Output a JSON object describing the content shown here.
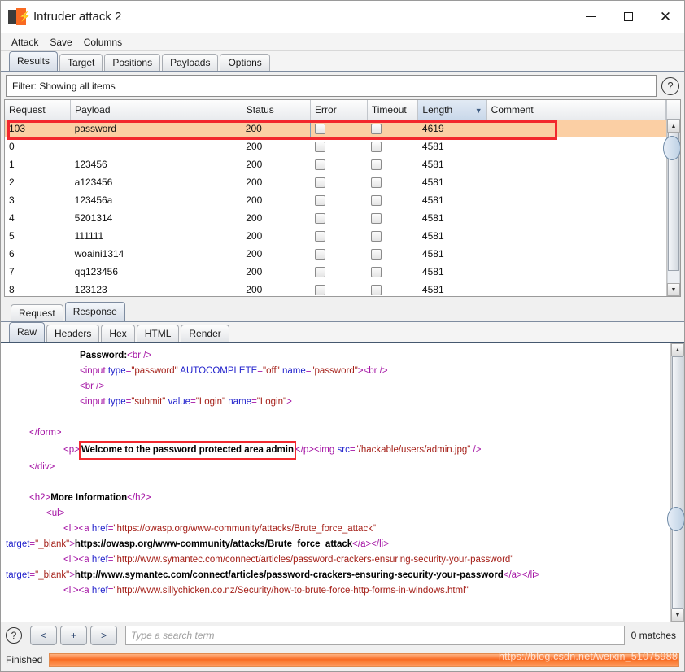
{
  "window": {
    "title": "Intruder attack 2",
    "icon": "burp-suite-logo",
    "minimize": "—",
    "maximize": "□",
    "close": "✕"
  },
  "menubar": {
    "items": [
      "Attack",
      "Save",
      "Columns"
    ]
  },
  "top_tabs": {
    "items": [
      "Results",
      "Target",
      "Positions",
      "Payloads",
      "Options"
    ],
    "active": "Results"
  },
  "filter": {
    "text": "Filter: Showing all items",
    "help_icon": "question-mark-icon",
    "help_glyph": "?"
  },
  "results_table": {
    "columns": [
      "Request",
      "Payload",
      "Status",
      "Error",
      "Timeout",
      "Length",
      "Comment"
    ],
    "sorted_column": "Length",
    "sort_arrow": "▼",
    "rows": [
      {
        "request": "103",
        "payload": "password",
        "status": "200",
        "error": "",
        "timeout": "",
        "length": "4619",
        "comment": "",
        "highlighted": true
      },
      {
        "request": "0",
        "payload": "",
        "status": "200",
        "error": "",
        "timeout": "",
        "length": "4581",
        "comment": "",
        "highlighted": false
      },
      {
        "request": "1",
        "payload": "123456",
        "status": "200",
        "error": "",
        "timeout": "",
        "length": "4581",
        "comment": "",
        "highlighted": false
      },
      {
        "request": "2",
        "payload": "a123456",
        "status": "200",
        "error": "",
        "timeout": "",
        "length": "4581",
        "comment": "",
        "highlighted": false
      },
      {
        "request": "3",
        "payload": "123456a",
        "status": "200",
        "error": "",
        "timeout": "",
        "length": "4581",
        "comment": "",
        "highlighted": false
      },
      {
        "request": "4",
        "payload": "5201314",
        "status": "200",
        "error": "",
        "timeout": "",
        "length": "4581",
        "comment": "",
        "highlighted": false
      },
      {
        "request": "5",
        "payload": "111111",
        "status": "200",
        "error": "",
        "timeout": "",
        "length": "4581",
        "comment": "",
        "highlighted": false
      },
      {
        "request": "6",
        "payload": "woaini1314",
        "status": "200",
        "error": "",
        "timeout": "",
        "length": "4581",
        "comment": "",
        "highlighted": false
      },
      {
        "request": "7",
        "payload": "qq123456",
        "status": "200",
        "error": "",
        "timeout": "",
        "length": "4581",
        "comment": "",
        "highlighted": false
      },
      {
        "request": "8",
        "payload": "123123",
        "status": "200",
        "error": "",
        "timeout": "",
        "length": "4581",
        "comment": "",
        "highlighted": false
      }
    ]
  },
  "rr_tabs": {
    "items": [
      "Request",
      "Response"
    ],
    "active": "Response"
  },
  "view_tabs": {
    "items": [
      "Raw",
      "Headers",
      "Hex",
      "HTML",
      "Render"
    ],
    "active": "Raw"
  },
  "response": {
    "lines": [
      [
        {
          "t": "Password:",
          "c": "tx"
        },
        {
          "t": "<br />",
          "c": "tg"
        }
      ],
      [
        {
          "t": "<input ",
          "c": "tg"
        },
        {
          "t": "type",
          "c": "at"
        },
        {
          "t": "=",
          "c": "tg"
        },
        {
          "t": "\"password\"",
          "c": "vl"
        },
        {
          "t": " AUTOCOMPLETE",
          "c": "at"
        },
        {
          "t": "=",
          "c": "tg"
        },
        {
          "t": "\"off\"",
          "c": "vl"
        },
        {
          "t": " name",
          "c": "at"
        },
        {
          "t": "=",
          "c": "tg"
        },
        {
          "t": "\"password\"",
          "c": "vl"
        },
        {
          "t": ">",
          "c": "tg"
        },
        {
          "t": "<br />",
          "c": "tg"
        }
      ],
      [
        {
          "t": "<br />",
          "c": "tg"
        }
      ],
      [
        {
          "t": "<input ",
          "c": "tg"
        },
        {
          "t": "type",
          "c": "at"
        },
        {
          "t": "=",
          "c": "tg"
        },
        {
          "t": "\"submit\"",
          "c": "vl"
        },
        {
          "t": " value",
          "c": "at"
        },
        {
          "t": "=",
          "c": "tg"
        },
        {
          "t": "\"Login\"",
          "c": "vl"
        },
        {
          "t": " name",
          "c": "at"
        },
        {
          "t": "=",
          "c": "tg"
        },
        {
          "t": "\"Login\"",
          "c": "vl"
        },
        {
          "t": ">",
          "c": "tg"
        }
      ],
      [],
      [
        {
          "t": "</form>",
          "c": "tg"
        }
      ],
      [
        {
          "t": "<p>",
          "c": "tg"
        },
        {
          "t": "Welcome to the password protected area admin",
          "c": "tx"
        },
        {
          "t": "</p>",
          "c": "tg"
        },
        {
          "t": "<img ",
          "c": "tg"
        },
        {
          "t": "src",
          "c": "at"
        },
        {
          "t": "=",
          "c": "tg"
        },
        {
          "t": "\"/hackable/users/admin.jpg\"",
          "c": "vl"
        },
        {
          "t": " />",
          "c": "tg"
        }
      ],
      [
        {
          "t": "</div>",
          "c": "tg"
        }
      ],
      [],
      [
        {
          "t": "<h2>",
          "c": "tg"
        },
        {
          "t": "More Information",
          "c": "tx"
        },
        {
          "t": "</h2>",
          "c": "tg"
        }
      ],
      [
        {
          "t": "<ul>",
          "c": "tg"
        }
      ],
      [
        {
          "t": "<li><a ",
          "c": "tg"
        },
        {
          "t": "href",
          "c": "at"
        },
        {
          "t": "=",
          "c": "tg"
        },
        {
          "t": "\"https://owasp.org/www-community/attacks/Brute_force_attack\"",
          "c": "vl"
        }
      ],
      [
        {
          "t": "target",
          "c": "at"
        },
        {
          "t": "=",
          "c": "tg"
        },
        {
          "t": "\"_blank\"",
          "c": "vl"
        },
        {
          "t": ">",
          "c": "tg"
        },
        {
          "t": "https://owasp.org/www-community/attacks/Brute_force_attack",
          "c": "tx"
        },
        {
          "t": "</a></li>",
          "c": "tg"
        }
      ],
      [
        {
          "t": "<li><a ",
          "c": "tg"
        },
        {
          "t": "href",
          "c": "at"
        },
        {
          "t": "=",
          "c": "tg"
        },
        {
          "t": "\"http://www.symantec.com/connect/articles/password-crackers-ensuring-security-your-password\"",
          "c": "vl"
        }
      ],
      [
        {
          "t": "target",
          "c": "at"
        },
        {
          "t": "=",
          "c": "tg"
        },
        {
          "t": "\"_blank\"",
          "c": "vl"
        },
        {
          "t": ">",
          "c": "tg"
        },
        {
          "t": "http://www.symantec.com/connect/articles/password-crackers-ensuring-security-your-password",
          "c": "tx"
        },
        {
          "t": "</a></li>",
          "c": "tg"
        }
      ],
      [
        {
          "t": "<li><a ",
          "c": "tg"
        },
        {
          "t": "href",
          "c": "at"
        },
        {
          "t": "=",
          "c": "tg"
        },
        {
          "t": "\"http://www.sillychicken.co.nz/Security/how-to-brute-force-http-forms-in-windows.html\"",
          "c": "vl"
        }
      ]
    ],
    "highlight_line_index": 6,
    "highlight_part_index": 1
  },
  "search_toolbar": {
    "help_icon": "question-mark-icon",
    "help_glyph": "?",
    "prev_label": "<",
    "add_label": "+",
    "next_label": ">",
    "placeholder": "Type a search term",
    "value": "",
    "matches": "0 matches"
  },
  "status": {
    "label": "Finished",
    "progress_percent": 100,
    "watermark": "https://blog.csdn.net/weixin_51075988"
  },
  "colors": {
    "accent_orange": "#f96a22",
    "highlight_row": "#fbcfa4",
    "annotation_red": "#f2282e",
    "tag": "#a413a4",
    "attribute": "#2222cc",
    "value": "#a52019"
  }
}
